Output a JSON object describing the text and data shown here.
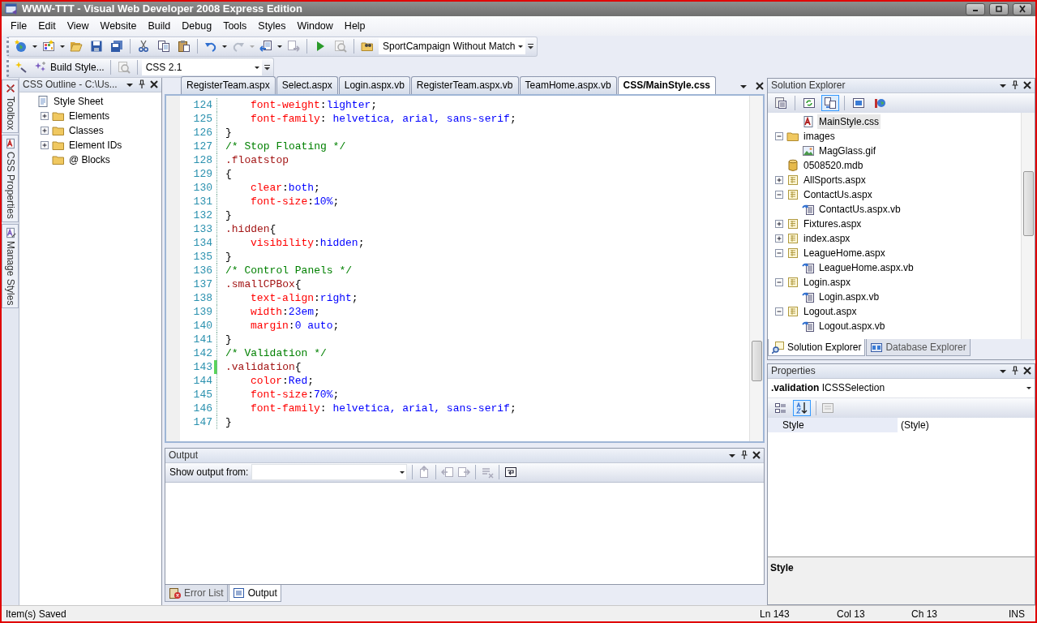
{
  "window": {
    "title": "WWW-TTT - Visual Web Developer 2008 Express Edition"
  },
  "menu": [
    "File",
    "Edit",
    "View",
    "Website",
    "Build",
    "Debug",
    "Tools",
    "Styles",
    "Window",
    "Help"
  ],
  "toolbar": {
    "solution_dropdown": "SportCampaign Without Match"
  },
  "style_toolbar": {
    "build_style": "Build Style...",
    "css_version": "CSS 2.1"
  },
  "side_tabs": [
    "Toolbox",
    "CSS Properties",
    "Manage Styles"
  ],
  "css_outline": {
    "title": "CSS Outline - C:\\Us...",
    "tree": [
      {
        "label": "Style Sheet",
        "kind": "sheet",
        "selected": false,
        "children": [
          {
            "label": "Elements",
            "kind": "folder",
            "selected": false,
            "expanded": false
          },
          {
            "label": "Classes",
            "kind": "folder",
            "selected": false,
            "expanded": false
          },
          {
            "label": "Element IDs",
            "kind": "folder",
            "selected": false,
            "expanded": false
          },
          {
            "label": "@ Blocks",
            "kind": "folder",
            "selected": false
          }
        ]
      }
    ]
  },
  "editor": {
    "tabs": [
      {
        "label": "RegisterTeam.aspx",
        "selected": false
      },
      {
        "label": "Select.aspx",
        "selected": false
      },
      {
        "label": "Login.aspx.vb",
        "selected": false
      },
      {
        "label": "RegisterTeam.aspx.vb",
        "selected": false
      },
      {
        "label": "TeamHome.aspx.vb",
        "selected": false
      },
      {
        "label": "CSS/MainStyle.css",
        "selected": true
      }
    ],
    "lines": [
      {
        "number": "124",
        "indented": true,
        "modified": false,
        "tokens": [
          {
            "kind": "property",
            "text": "font-weight"
          },
          {
            "kind": "plain",
            "text": ":"
          },
          {
            "kind": "value",
            "text": "lighter"
          },
          {
            "kind": "plain",
            "text": ";"
          }
        ]
      },
      {
        "number": "125",
        "indented": true,
        "modified": false,
        "tokens": [
          {
            "kind": "property",
            "text": "font-family"
          },
          {
            "kind": "plain",
            "text": ": "
          },
          {
            "kind": "value",
            "text": "helvetica, arial, sans-serif"
          },
          {
            "kind": "plain",
            "text": ";"
          }
        ]
      },
      {
        "number": "126",
        "indented": false,
        "modified": false,
        "tokens": [
          {
            "kind": "plain",
            "text": "}"
          }
        ]
      },
      {
        "number": "127",
        "indented": false,
        "modified": false,
        "tokens": [
          {
            "kind": "comment",
            "text": "/* Stop Floating */"
          }
        ]
      },
      {
        "number": "128",
        "indented": false,
        "modified": false,
        "tokens": [
          {
            "kind": "selector",
            "text": ".floatstop"
          }
        ]
      },
      {
        "number": "129",
        "indented": false,
        "modified": false,
        "tokens": [
          {
            "kind": "plain",
            "text": "{"
          }
        ]
      },
      {
        "number": "130",
        "indented": true,
        "modified": false,
        "tokens": [
          {
            "kind": "property",
            "text": "clear"
          },
          {
            "kind": "plain",
            "text": ":"
          },
          {
            "kind": "value",
            "text": "both"
          },
          {
            "kind": "plain",
            "text": ";"
          }
        ]
      },
      {
        "number": "131",
        "indented": true,
        "modified": false,
        "tokens": [
          {
            "kind": "property",
            "text": "font-size"
          },
          {
            "kind": "plain",
            "text": ":"
          },
          {
            "kind": "value",
            "text": "10%"
          },
          {
            "kind": "plain",
            "text": ";"
          }
        ]
      },
      {
        "number": "132",
        "indented": false,
        "modified": false,
        "tokens": [
          {
            "kind": "plain",
            "text": "}"
          }
        ]
      },
      {
        "number": "133",
        "indented": false,
        "modified": false,
        "tokens": [
          {
            "kind": "selector",
            "text": ".hidden"
          },
          {
            "kind": "plain",
            "text": "{"
          }
        ]
      },
      {
        "number": "134",
        "indented": true,
        "modified": false,
        "tokens": [
          {
            "kind": "property",
            "text": "visibility"
          },
          {
            "kind": "plain",
            "text": ":"
          },
          {
            "kind": "value",
            "text": "hidden"
          },
          {
            "kind": "plain",
            "text": ";"
          }
        ]
      },
      {
        "number": "135",
        "indented": false,
        "modified": false,
        "tokens": [
          {
            "kind": "plain",
            "text": "}"
          }
        ]
      },
      {
        "number": "136",
        "indented": false,
        "modified": false,
        "tokens": [
          {
            "kind": "comment",
            "text": "/* Control Panels */"
          }
        ]
      },
      {
        "number": "137",
        "indented": false,
        "modified": false,
        "tokens": [
          {
            "kind": "selector",
            "text": ".smallCPBox"
          },
          {
            "kind": "plain",
            "text": "{"
          }
        ]
      },
      {
        "number": "138",
        "indented": true,
        "modified": false,
        "tokens": [
          {
            "kind": "property",
            "text": "text-align"
          },
          {
            "kind": "plain",
            "text": ":"
          },
          {
            "kind": "value",
            "text": "right"
          },
          {
            "kind": "plain",
            "text": ";"
          }
        ]
      },
      {
        "number": "139",
        "indented": true,
        "modified": false,
        "tokens": [
          {
            "kind": "property",
            "text": "width"
          },
          {
            "kind": "plain",
            "text": ":"
          },
          {
            "kind": "value",
            "text": "23em"
          },
          {
            "kind": "plain",
            "text": ";"
          }
        ]
      },
      {
        "number": "140",
        "indented": true,
        "modified": false,
        "tokens": [
          {
            "kind": "property",
            "text": "margin"
          },
          {
            "kind": "plain",
            "text": ":"
          },
          {
            "kind": "value",
            "text": "0 auto"
          },
          {
            "kind": "plain",
            "text": ";"
          }
        ]
      },
      {
        "number": "141",
        "indented": false,
        "modified": false,
        "tokens": [
          {
            "kind": "plain",
            "text": "}"
          }
        ]
      },
      {
        "number": "142",
        "indented": false,
        "modified": false,
        "tokens": [
          {
            "kind": "comment",
            "text": "/* Validation */"
          }
        ]
      },
      {
        "number": "143",
        "indented": false,
        "modified": true,
        "tokens": [
          {
            "kind": "selector",
            "text": ".validation"
          },
          {
            "kind": "plain",
            "text": "{"
          }
        ]
      },
      {
        "number": "144",
        "indented": true,
        "modified": false,
        "tokens": [
          {
            "kind": "property",
            "text": "color"
          },
          {
            "kind": "plain",
            "text": ":"
          },
          {
            "kind": "value",
            "text": "Red"
          },
          {
            "kind": "plain",
            "text": ";"
          }
        ]
      },
      {
        "number": "145",
        "indented": true,
        "modified": false,
        "tokens": [
          {
            "kind": "property",
            "text": "font-size"
          },
          {
            "kind": "plain",
            "text": ":"
          },
          {
            "kind": "value",
            "text": "70%"
          },
          {
            "kind": "plain",
            "text": ";"
          }
        ]
      },
      {
        "number": "146",
        "indented": true,
        "modified": false,
        "tokens": [
          {
            "kind": "property",
            "text": "font-family"
          },
          {
            "kind": "plain",
            "text": ": "
          },
          {
            "kind": "value",
            "text": "helvetica, arial, sans-serif"
          },
          {
            "kind": "plain",
            "text": ";"
          }
        ]
      },
      {
        "number": "147",
        "indented": false,
        "modified": false,
        "tokens": [
          {
            "kind": "plain",
            "text": "}"
          }
        ]
      }
    ]
  },
  "output": {
    "title": "Output",
    "show_from_label": "Show output from:",
    "tabs": [
      {
        "label": "Error List",
        "kind": "errors",
        "selected": false
      },
      {
        "label": "Output",
        "kind": "output",
        "selected": true
      }
    ]
  },
  "solution_explorer": {
    "title": "Solution Explorer",
    "items": [
      {
        "kind": "continuation",
        "children": [
          {
            "label": "MainStyle.css",
            "kind": "css",
            "selected": true
          }
        ]
      },
      {
        "label": "images",
        "kind": "folder",
        "selected": false,
        "expanded": true,
        "children": [
          {
            "label": "MagGlass.gif",
            "kind": "image",
            "selected": false
          }
        ]
      },
      {
        "label": "0508520.mdb",
        "kind": "database",
        "selected": false
      },
      {
        "label": "AllSports.aspx",
        "kind": "page",
        "selected": false,
        "expanded": false
      },
      {
        "label": "ContactUs.aspx",
        "kind": "page",
        "selected": false,
        "expanded": true,
        "children": [
          {
            "label": "ContactUs.aspx.vb",
            "kind": "code",
            "selected": false
          }
        ]
      },
      {
        "label": "Fixtures.aspx",
        "kind": "page",
        "selected": false,
        "expanded": false
      },
      {
        "label": "index.aspx",
        "kind": "page",
        "selected": false,
        "expanded": false
      },
      {
        "label": "LeagueHome.aspx",
        "kind": "page",
        "selected": false,
        "expanded": true,
        "children": [
          {
            "label": "LeagueHome.aspx.vb",
            "kind": "code",
            "selected": false
          }
        ]
      },
      {
        "label": "Login.aspx",
        "kind": "page",
        "selected": false,
        "expanded": true,
        "children": [
          {
            "label": "Login.aspx.vb",
            "kind": "code",
            "selected": false
          }
        ]
      },
      {
        "label": "Logout.aspx",
        "kind": "page",
        "selected": false,
        "expanded": true,
        "children": [
          {
            "label": "Logout.aspx.vb",
            "kind": "code",
            "selected": false
          }
        ]
      }
    ],
    "tabs": [
      {
        "label": "Solution Explorer",
        "kind": "solution",
        "selected": true
      },
      {
        "label": "Database Explorer",
        "kind": "database",
        "selected": false
      }
    ]
  },
  "properties": {
    "title": "Properties",
    "object": "**.validation** ICSSSelection",
    "sort_buttons": [
      {
        "kind": "categorized",
        "selected": false
      },
      {
        "kind": "alphabetical",
        "selected": true
      }
    ],
    "rows": [
      {
        "name": "Style",
        "value": "(Style)"
      }
    ],
    "description_title": "Style"
  },
  "status_bar": {
    "message": "Item(s) Saved",
    "line": "Ln 143",
    "column": "Col 13",
    "char": "Ch 13",
    "mode": "INS"
  }
}
